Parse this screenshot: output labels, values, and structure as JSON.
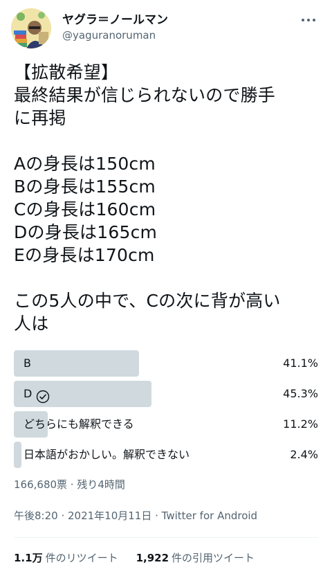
{
  "user": {
    "display_name": "ヤグラ＝ノールマン",
    "username": "@yaguranoruman"
  },
  "tweet": {
    "text": "【拡散希望】\n最終結果が信じられないので勝手\nに再掲\n\nAの身長は150cm\nBの身長は155cm\nCの身長は160cm\nDの身長は165cm\nEの身長は170cm\n\nこの5人の中で、Cの次に背が高い\n人は"
  },
  "poll": {
    "options": [
      {
        "label": "B",
        "percent": "41.1%",
        "fraction": 0.411,
        "winner": false
      },
      {
        "label": "D",
        "percent": "45.3%",
        "fraction": 0.453,
        "winner": true
      },
      {
        "label": "どちらにも解釈できる",
        "percent": "11.2%",
        "fraction": 0.112,
        "winner": false
      },
      {
        "label": "日本語がおかしい。解釈できない",
        "percent": "2.4%",
        "fraction": 0.024,
        "winner": false
      }
    ],
    "meta": "166,680票 · 残り4時間"
  },
  "timestamp": "午後8:20 · 2021年10月11日 · Twitter for Android",
  "stats": {
    "retweets_num": "1.1万",
    "retweets_label": "件のリツイート",
    "quotes_num": "1,922",
    "quotes_label": "件の引用ツイート"
  },
  "colors": {
    "poll_bar": "#cfd9de",
    "secondary_text": "#536471",
    "primary_text": "#0f1419"
  },
  "icons": {
    "more": "more-horizontal-icon",
    "check": "check-circle-icon"
  }
}
